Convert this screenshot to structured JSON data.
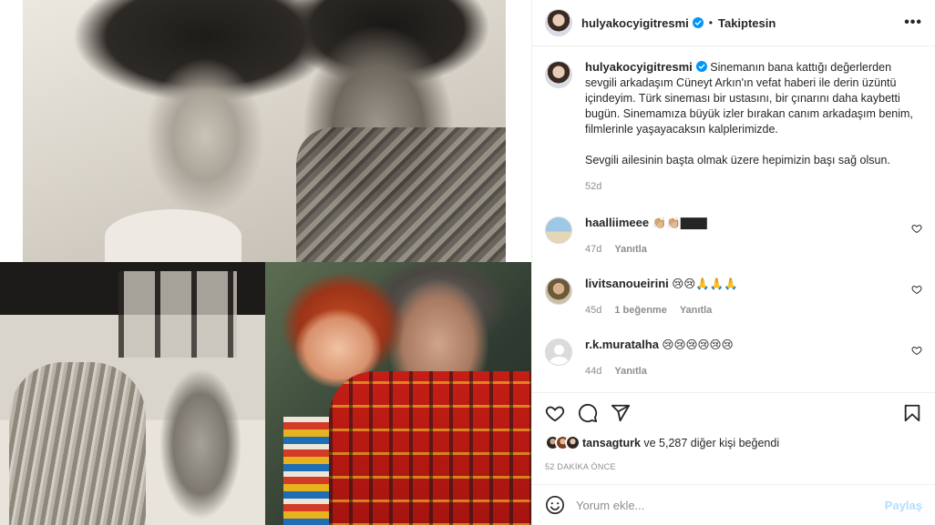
{
  "post": {
    "author": "hulyakocyigitresmi",
    "follow_state": "Takiptesin",
    "more_label": "•••",
    "caption": "Sinemanın bana kattığı değerlerden sevgili arkadaşım Cüneyt Arkın'ın vefat haberi ile derin üzüntü içindeyim. Türk sineması bir ustasını, bir çınarını daha kaybetti bugün. Sinemamıza büyük izler bırakan canım arkadaşım benim, filmlerinle yaşayacaksın kalplerimizde.\n\nSevgili ailesinin başta olmak üzere hepimizin başı sağ olsun.",
    "caption_age": "52d"
  },
  "comments": [
    {
      "user": "haalliimeee",
      "text": "👏🏼👏🏼▇▇▇",
      "age": "47d",
      "likes": "",
      "reply_label": "Yanıtla"
    },
    {
      "user": "livitsanoueirini",
      "text": "😢😢🙏🙏🙏",
      "age": "45d",
      "likes": "1 beğenme",
      "reply_label": "Yanıtla"
    },
    {
      "user": "r.k.muratalha",
      "text": "😢😢😢😢😢😢",
      "age": "44d",
      "likes": "",
      "reply_label": "Yanıtla"
    }
  ],
  "likes": {
    "user": "tansagturk",
    "rest": " ve 5,287 diğer kişi beğendi"
  },
  "time_ago": "52 DAKİKA ÖNCE",
  "add_comment": {
    "placeholder": "Yorum ekle...",
    "post_label": "Paylaş"
  },
  "colors": {
    "verified": "#0095f6",
    "post_button_disabled": "#b2dffc",
    "meta": "#8e8e8e"
  }
}
